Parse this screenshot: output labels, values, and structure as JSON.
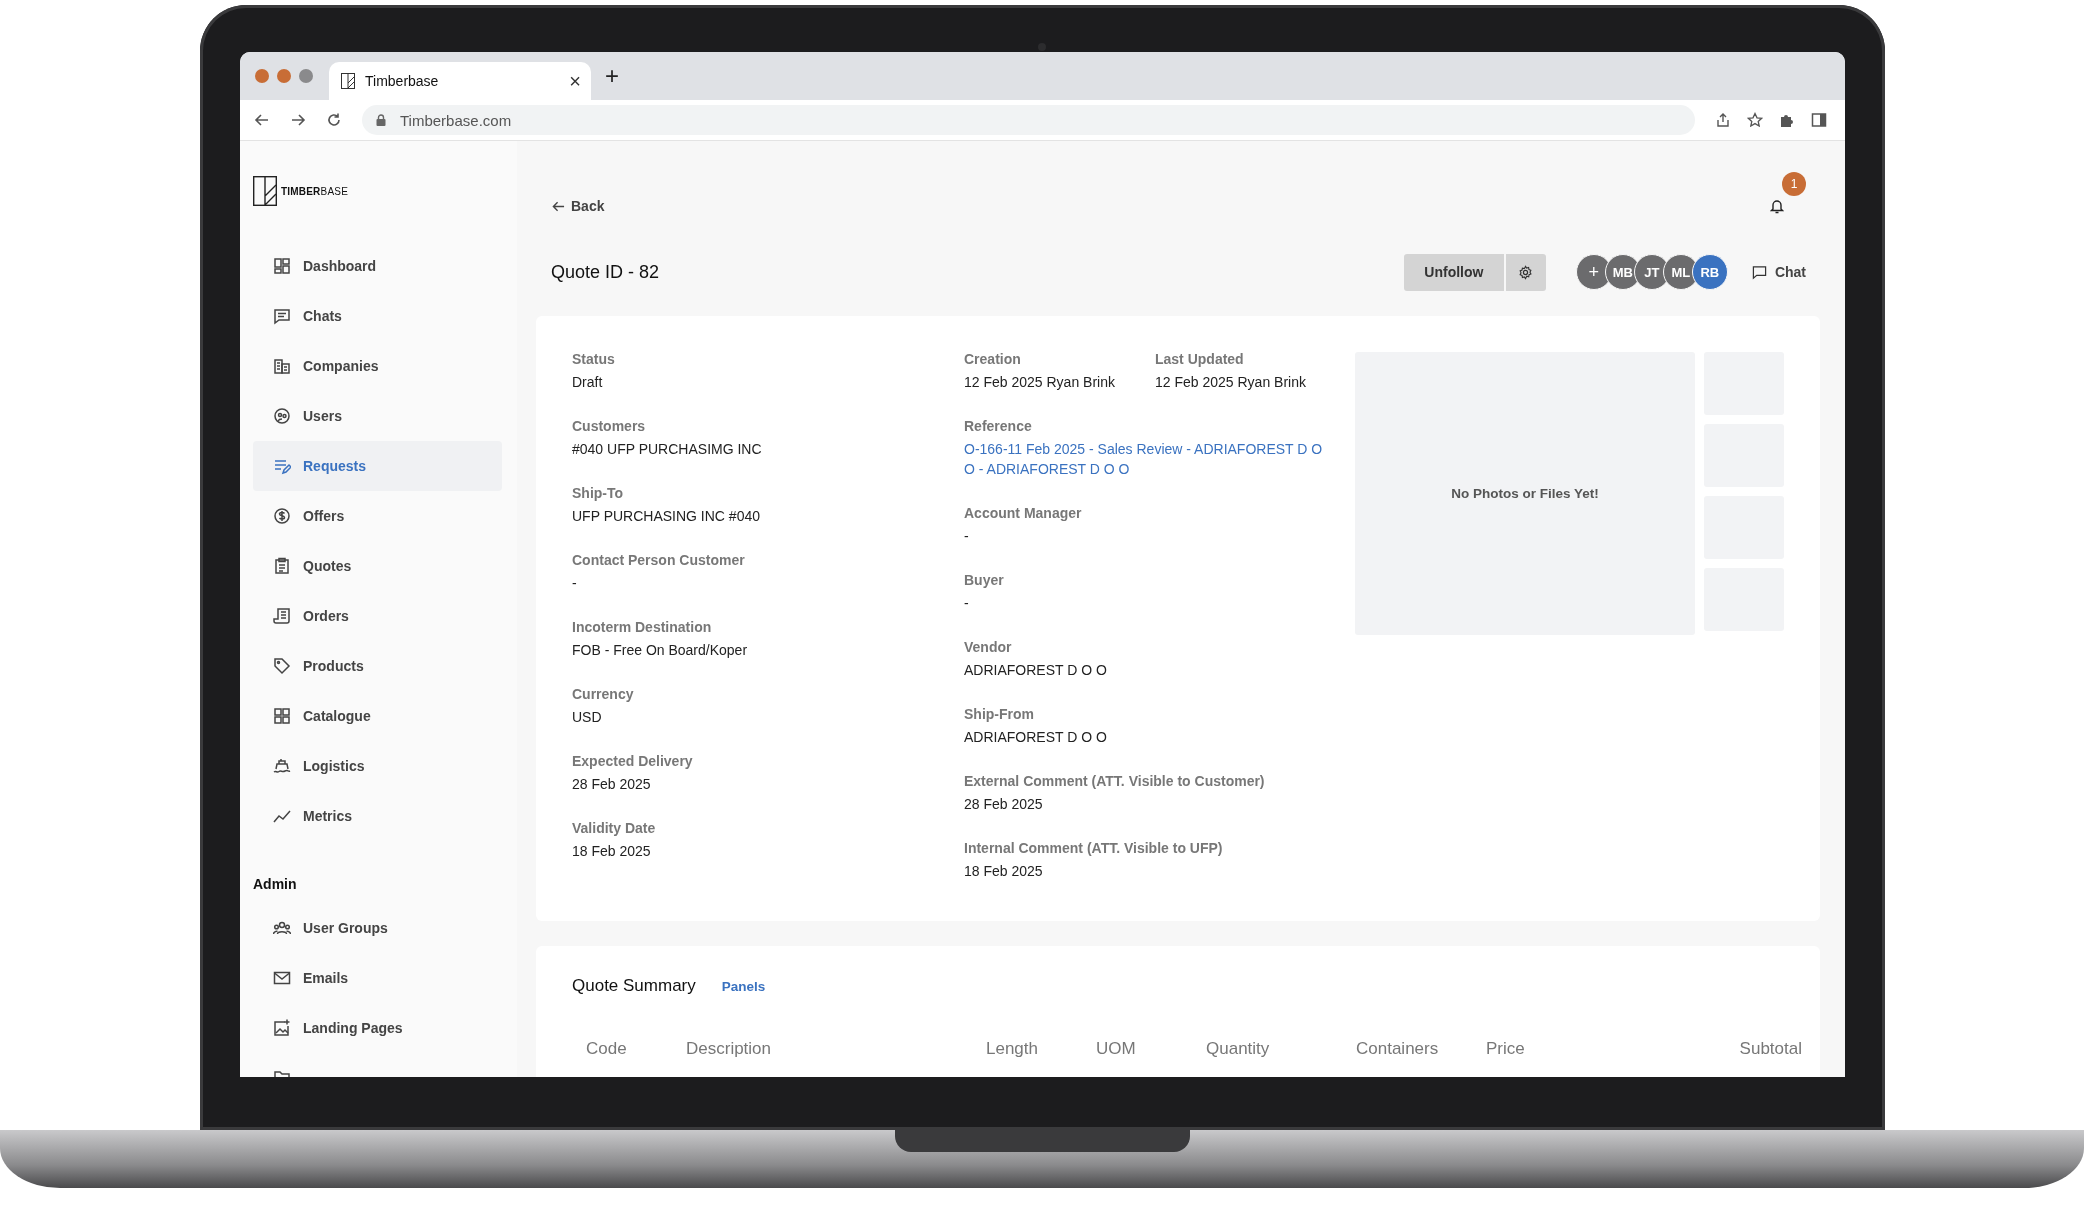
{
  "logo": {
    "wordmark": "**TIMBER**BASE"
  },
  "browser": {
    "tab_title": "Timberbase",
    "close": "×",
    "new_tab": "+",
    "url": "Timberbase.com"
  },
  "sidebar": {
    "items": [
      {
        "label": "Dashboard",
        "selected": false
      },
      {
        "label": "Chats",
        "selected": false
      },
      {
        "label": "Companies",
        "selected": false
      },
      {
        "label": "Users",
        "selected": false
      },
      {
        "label": "Requests",
        "selected": true
      },
      {
        "label": "Offers",
        "selected": false
      },
      {
        "label": "Quotes",
        "selected": false
      },
      {
        "label": "Orders",
        "selected": false
      },
      {
        "label": "Products",
        "selected": false
      },
      {
        "label": "Catalogue",
        "selected": false
      },
      {
        "label": "Logistics",
        "selected": false
      },
      {
        "label": "Metrics",
        "selected": false
      }
    ],
    "admin_heading": "Admin",
    "admin_items": [
      {
        "label": "User Groups"
      },
      {
        "label": "Emails"
      },
      {
        "label": "Landing Pages"
      }
    ]
  },
  "header": {
    "back": "Back",
    "notifications": "1",
    "title": "Quote ID - 82",
    "unfollow": "Unfollow",
    "avatars": [
      {
        "initials": "+",
        "color": "#6b6b6d"
      },
      {
        "initials": "MB",
        "color": "#6b6b6d"
      },
      {
        "initials": "JT",
        "color": "#6b6b6d"
      },
      {
        "initials": "ML",
        "color": "#6b6b6d"
      },
      {
        "initials": "RB",
        "color": "#3a72c0"
      }
    ],
    "chat": "Chat"
  },
  "details": {
    "left": [
      {
        "label": "Status",
        "value": "Draft"
      },
      {
        "label": "Customers",
        "value": "#040 UFP PURCHASIMG INC"
      },
      {
        "label": "Ship-To",
        "value": "UFP PURCHASING INC #040"
      },
      {
        "label": "Contact Person Customer",
        "value": "-"
      },
      {
        "label": "Incoterm Destination",
        "value": "FOB - Free On Board/Koper"
      },
      {
        "label": "Currency",
        "value": "USD"
      },
      {
        "label": "Expected Delivery",
        "value": "28 Feb 2025"
      },
      {
        "label": "Validity Date",
        "value": "18 Feb 2025"
      }
    ],
    "right": [
      [
        {
          "label": "Creation",
          "value": "12 Feb 2025 Ryan Brink",
          "kind": "text"
        },
        {
          "label": "Last Updated",
          "value": "12 Feb 2025 Ryan Brink",
          "kind": "text"
        }
      ],
      [
        {
          "label": "Reference",
          "value": "O-166-11 Feb 2025 - Sales Review - ADRIAFOREST D O O - ADRIAFOREST D O O",
          "kind": "link"
        }
      ],
      [
        {
          "label": "Account Manager",
          "value": "-",
          "kind": "text"
        }
      ],
      [
        {
          "label": "Buyer",
          "value": "-",
          "kind": "text"
        }
      ],
      [
        {
          "label": "Vendor",
          "value": "ADRIAFOREST D O O",
          "kind": "text"
        }
      ],
      [
        {
          "label": "Ship-From",
          "value": "ADRIAFOREST D O O",
          "kind": "text"
        }
      ],
      [
        {
          "label": "External Comment (ATT. Visible to Customer)",
          "value": "28 Feb 2025",
          "kind": "text"
        }
      ],
      [
        {
          "label": "Internal Comment (ATT. Visible to UFP)",
          "value": "18 Feb 2025",
          "kind": "text"
        }
      ]
    ],
    "media": {
      "empty_text": "No Photos or Files Yet!",
      "thumbnails": [
        {
          "kind": "placeholder"
        },
        {
          "kind": "placeholder"
        },
        {
          "kind": "placeholder"
        },
        {
          "kind": "placeholder"
        }
      ]
    }
  },
  "summary": {
    "title": "Quote Summary",
    "tab": "Panels",
    "columns": [
      "Code",
      "Description",
      "Length",
      "UOM",
      "Quantity",
      "Containers",
      "Price",
      "Subtotal"
    ]
  }
}
